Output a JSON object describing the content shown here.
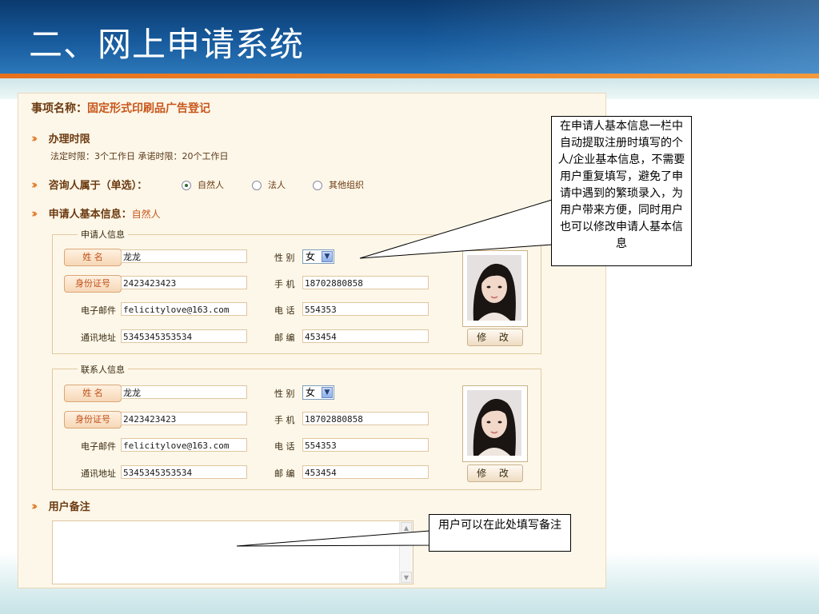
{
  "slide": {
    "title": "二、网上申请系统"
  },
  "form": {
    "item_label": "事项名称：",
    "item_value": "固定形式印刷品广告登记",
    "time_limit_title": "办理时限",
    "time_limit_text": "法定时限：3个工作日  承诺时限：20个工作日",
    "consult_title": "咨询人属于（单选）：",
    "consult_options": [
      {
        "label": "自然人",
        "selected": true
      },
      {
        "label": "法人",
        "selected": false
      },
      {
        "label": "其他组织",
        "selected": false
      }
    ],
    "applicant_info_title": "申请人基本信息：",
    "applicant_info_value": "自然人",
    "applicant": {
      "legend": "申请人信息",
      "name_label": "姓 名",
      "name": "龙龙",
      "id_label": "身份证号",
      "id": "2423423423",
      "email_label": "电子邮件",
      "email": "felicitylove@163.com",
      "address_label": "通讯地址",
      "address": "5345345353534",
      "gender_label": "性 别",
      "gender": "女",
      "mobile_label": "手 机",
      "mobile": "18702880858",
      "phone_label": "电 话",
      "phone": "554353",
      "postcode_label": "邮 编",
      "postcode": "453454",
      "modify_label": "修 改"
    },
    "contact": {
      "legend": "联系人信息",
      "name_label": "姓 名",
      "name": "龙龙",
      "id_label": "身份证号",
      "id": "2423423423",
      "email_label": "电子邮件",
      "email": "felicitylove@163.com",
      "address_label": "通讯地址",
      "address": "5345345353534",
      "gender_label": "性 别",
      "gender": "女",
      "mobile_label": "手 机",
      "mobile": "18702880858",
      "phone_label": "电 话",
      "phone": "554353",
      "postcode_label": "邮 编",
      "postcode": "453454",
      "modify_label": "修 改"
    },
    "remarks_title": "用户备注"
  },
  "callouts": {
    "info": "在申请人基本信息一栏中自动提取注册时填写的个人/企业基本信息，不需要用户重复填写，避免了申请中遇到的繁琐录入，为用户带来方便，同时用户也可以修改申请人基本信息",
    "remarks": "用户可以在此处填写备注"
  },
  "colors": {
    "header": "#175a9c",
    "accent": "#e7701c",
    "panel": "#fdf7e9",
    "label_brown": "#6b3a10"
  }
}
